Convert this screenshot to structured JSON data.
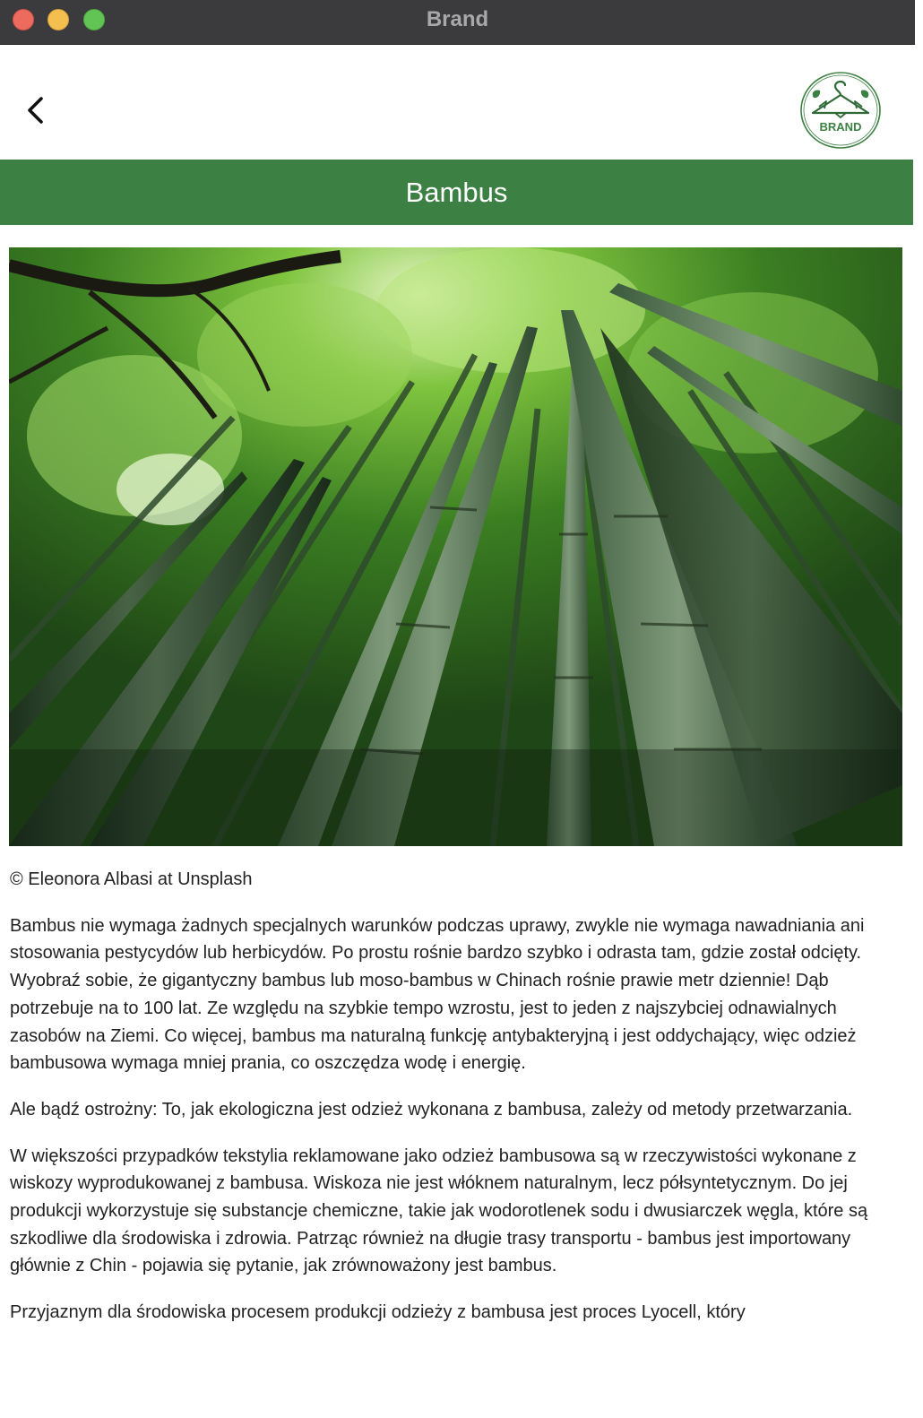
{
  "window": {
    "title": "Brand",
    "buttons": [
      "close",
      "minimize",
      "zoom"
    ]
  },
  "appbar": {
    "back_icon": "chevron-left-icon",
    "logo": {
      "text": "BRAND",
      "icon": "hanger-leaves-logo",
      "color": "#3c8043"
    }
  },
  "banner": {
    "title": "Bambus",
    "background": "#3c8043"
  },
  "photo": {
    "subject": "bamboo-forest-photo"
  },
  "article": {
    "credit": "© Eleonora Albasi at Unsplash",
    "paragraphs": [
      "Bambus nie wymaga żadnych specjalnych warunków podczas uprawy, zwykle nie wymaga nawadniania ani stosowania pestycydów lub herbicydów. Po prostu rośnie bardzo szybko i odrasta tam, gdzie został odcięty. Wyobraź sobie, że gigantyczny bambus lub moso-bambus w Chinach rośnie prawie metr dziennie! Dąb potrzebuje na to 100 lat. Ze względu na szybkie tempo wzrostu, jest to jeden z najszybciej odnawialnych zasobów na Ziemi. Co więcej, bambus ma naturalną funkcję antybakteryjną i jest oddychający, więc odzież bambusowa wymaga mniej prania, co oszczędza wodę i energię.",
      "Ale bądź ostrożny: To, jak ekologiczna jest odzież wykonana z bambusa, zależy od metody przetwarzania.",
      "W większości przypadków tekstylia reklamowane jako odzież bambusowa są w rzeczywistości wykonane z wiskozy wyprodukowanej z bambusa. Wiskoza nie jest włóknem naturalnym, lecz półsyntetycznym. Do jej produkcji wykorzystuje się substancje chemiczne, takie jak wodorotlenek sodu i dwusiarczek węgla, które są szkodliwe dla środowiska i zdrowia. Patrząc również na długie trasy transportu - bambus jest importowany głównie z Chin - pojawia się pytanie, jak zrównoważony jest bambus.",
      "Przyjaznym dla środowiska procesem produkcji odzieży z bambusa jest proces Lyocell, który"
    ]
  }
}
